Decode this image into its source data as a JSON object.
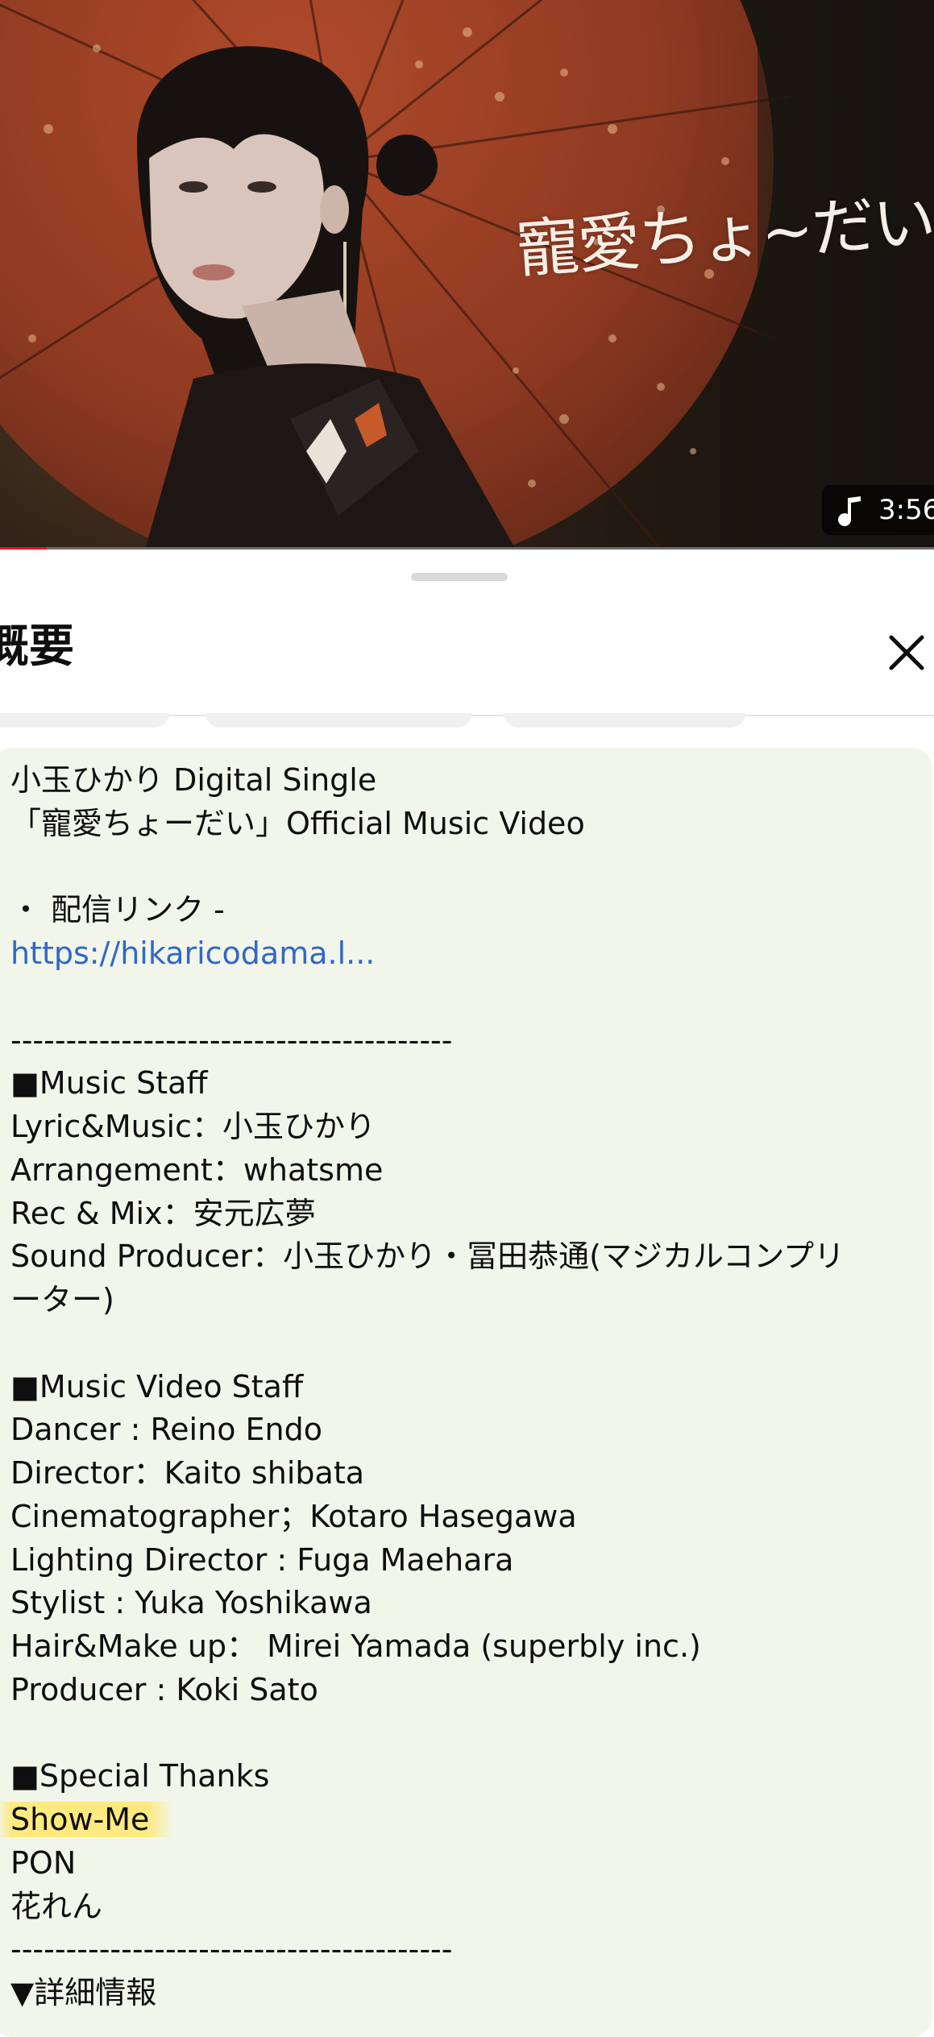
{
  "video": {
    "title_overlay": "寵愛ちょ~だい",
    "duration": "3:56",
    "progress_fraction": 0.05,
    "note_icon": "music-note-icon"
  },
  "sheet": {
    "title": "概要",
    "close_icon": "close-icon"
  },
  "description": {
    "lines": [
      "小玉ひかり Digital Single",
      "「寵愛ちょーだい」Official Music Video",
      "",
      "・ 配信リンク -",
      "https://hikaricodama.l...",
      "",
      "----------------------------------------",
      "■Music Staff",
      "Lyric&Music：小玉ひかり",
      "Arrangement：whatsme",
      "Rec & Mix：安元広夢",
      "Sound Producer：小玉ひかり・冨田恭通(マジカルコンプリ",
      "ーター)",
      "",
      "■Music Video Staff",
      "Dancer : Reino Endo",
      "Director：Kaito shibata",
      "Cinematographer；Kotaro Hasegawa",
      "Lighting Director : Fuga Maehara",
      "Stylist : Yuka Yoshikawa",
      "Hair&Make up： Mirei Yamada (superbly inc.)",
      "Producer : Koki Sato",
      "",
      "■Special Thanks",
      "Show-Me",
      "PON",
      "花れん",
      "----------------------------------------",
      "▼詳細情報"
    ],
    "link_line_index": 4,
    "highlight_line_index": 24
  },
  "colors": {
    "progress": "#ff0033",
    "link": "#3167c8",
    "card_bg": "#f2f6ea",
    "highlight": "#ffe978"
  }
}
